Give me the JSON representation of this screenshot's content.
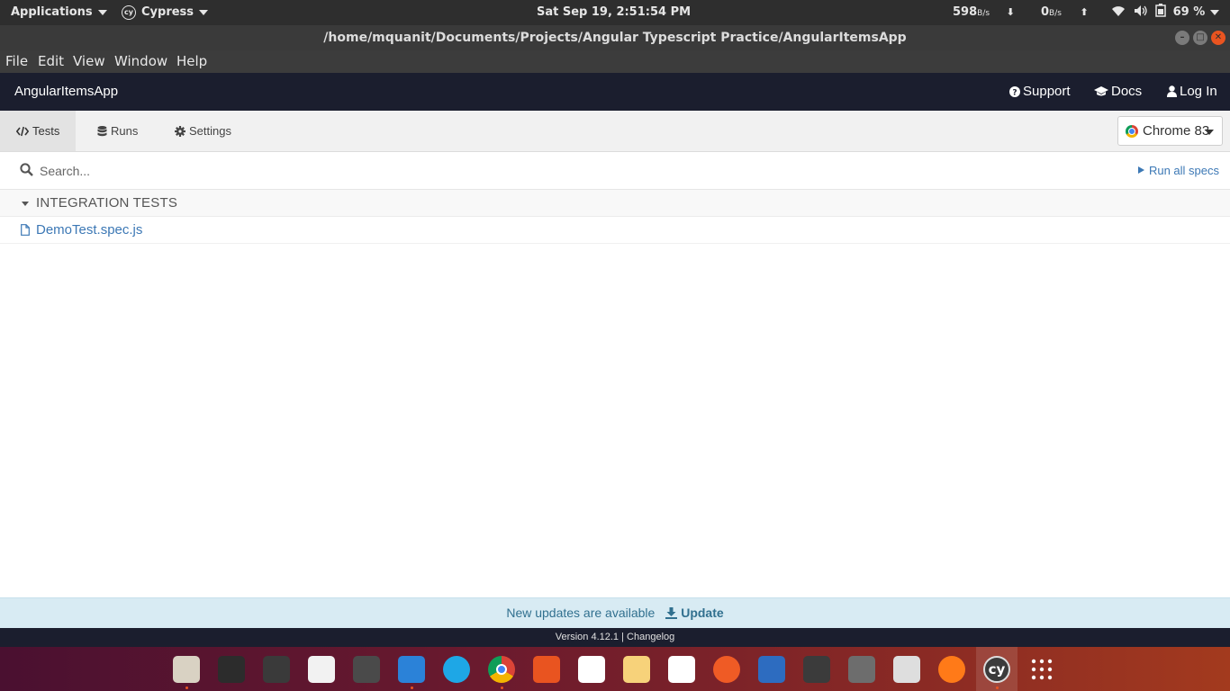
{
  "topbar": {
    "applications_label": "Applications",
    "active_app_label": "Cypress",
    "active_app_icon_text": "cy",
    "clock": "Sat Sep 19,  2:51:54 PM",
    "net_down_value": "598",
    "net_down_unit": "B/s",
    "net_up_value": "0",
    "net_up_unit": "B/s",
    "battery_percent": "69 %"
  },
  "window": {
    "title": "/home/mquanit/Documents/Projects/Angular Typescript Practice/AngularItemsApp"
  },
  "menubar": {
    "items": [
      {
        "label": "File"
      },
      {
        "label": "Edit"
      },
      {
        "label": "View"
      },
      {
        "label": "Window"
      },
      {
        "label": "Help"
      }
    ]
  },
  "header": {
    "project_name": "AngularItemsApp",
    "support_label": "Support",
    "docs_label": "Docs",
    "login_label": "Log In"
  },
  "tabs": {
    "tests_label": "Tests",
    "runs_label": "Runs",
    "settings_label": "Settings",
    "active": "Tests"
  },
  "browser": {
    "selected": "Chrome 83"
  },
  "search": {
    "placeholder": "Search...",
    "value": ""
  },
  "run_all_label": "Run all specs",
  "specs": {
    "folder_label": "INTEGRATION TESTS",
    "files": [
      {
        "name": "DemoTest.spec.js"
      }
    ]
  },
  "update_banner": {
    "message": "New updates are available",
    "action_label": "Update"
  },
  "footer": {
    "version_text": "Version 4.12.1",
    "separator": "|",
    "changelog_label": "Changelog"
  },
  "dock": {
    "apps": [
      {
        "icon": "files-icon",
        "color": "#d9d2c3",
        "running": true
      },
      {
        "icon": "terminal-icon",
        "color": "#2c2c2c",
        "running": false
      },
      {
        "icon": "system-monitor-icon",
        "color": "#3a3a3a",
        "running": false
      },
      {
        "icon": "text-editor-icon",
        "color": "#f2f2f2",
        "running": false
      },
      {
        "icon": "sublime-text-icon",
        "color": "#4a4a4a",
        "running": false
      },
      {
        "icon": "vscode-icon",
        "color": "#2b82d8",
        "running": true
      },
      {
        "icon": "skype-icon",
        "color": "#1ea7e6",
        "running": false
      },
      {
        "icon": "chrome-icon",
        "color": "#4285f4",
        "running": true
      },
      {
        "icon": "software-center-icon",
        "color": "#e95420",
        "running": false
      },
      {
        "icon": "writer-icon",
        "color": "#ffffff",
        "running": false
      },
      {
        "icon": "impress-icon",
        "color": "#f7d27a",
        "running": false
      },
      {
        "icon": "calc-icon",
        "color": "#ffffff",
        "running": false
      },
      {
        "icon": "postman-icon",
        "color": "#ef5b25",
        "running": false
      },
      {
        "icon": "tasks-icon",
        "color": "#2d6cc0",
        "running": false
      },
      {
        "icon": "calculator-icon",
        "color": "#3b3b3b",
        "running": false
      },
      {
        "icon": "system-settings-icon",
        "color": "#6d6d6d",
        "running": false
      },
      {
        "icon": "mixer-icon",
        "color": "#dedede",
        "running": false
      },
      {
        "icon": "firefox-icon",
        "color": "#ff7a18",
        "running": false
      },
      {
        "icon": "cypress-icon",
        "color": "#3b3b3b",
        "running": true
      },
      {
        "icon": "show-apps-icon",
        "color": "transparent",
        "running": false
      }
    ]
  }
}
